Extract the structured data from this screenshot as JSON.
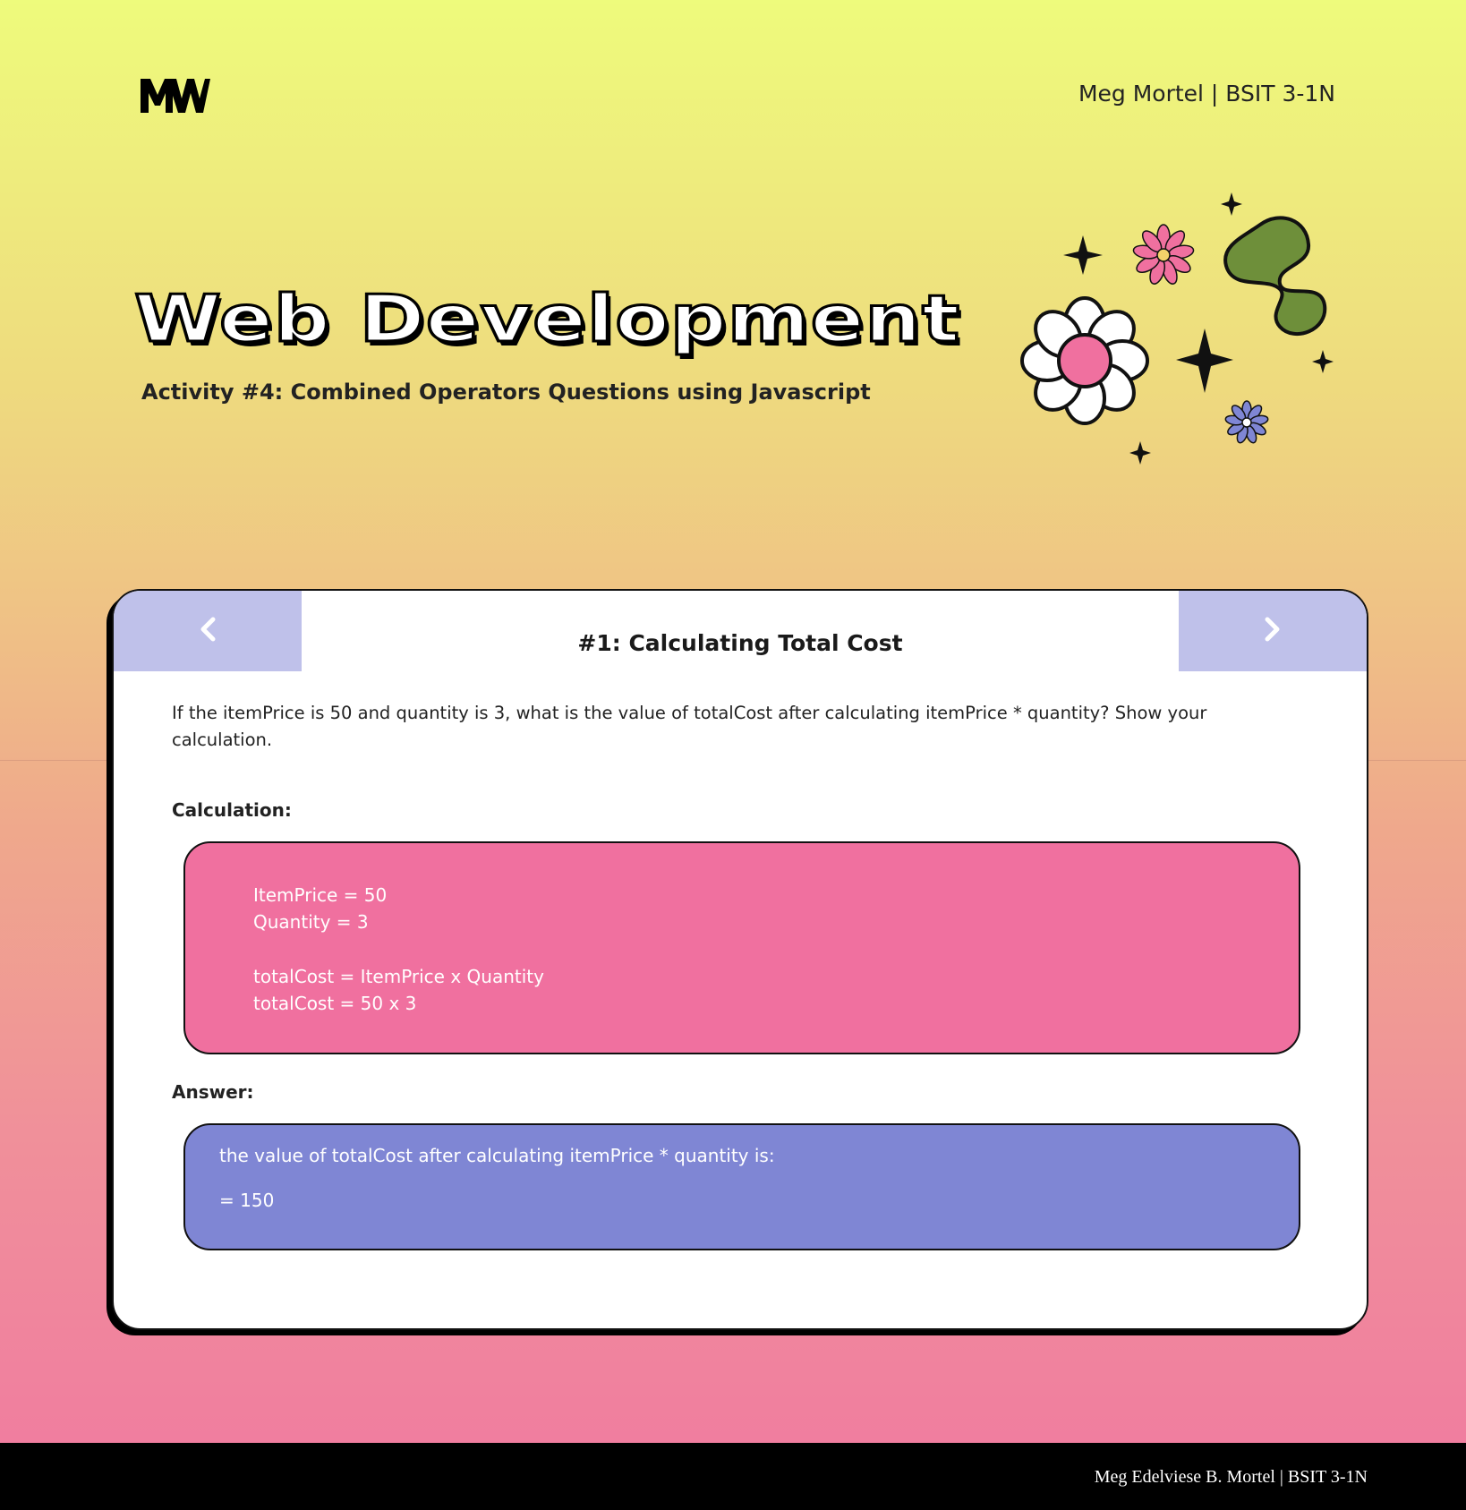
{
  "logo": {
    "text": "MW",
    "icon": "mw-logo-icon"
  },
  "header": {
    "author": "Meg Mortel | BSIT 3-1N"
  },
  "hero": {
    "title": "Web Development",
    "subtitle": "Activity #4: Combined Operators Questions using Javascript",
    "decoration": "flowers-and-sparkles-icon"
  },
  "colors": {
    "accent_pink": "#f0709f",
    "accent_purple": "#7f86d4",
    "nav_lavender": "#bfc1ea",
    "footer": "#000000"
  },
  "card": {
    "prev_icon": "chevron-left-icon",
    "next_icon": "chevron-right-icon",
    "question_title": "#1: Calculating Total Cost",
    "question_text": "If the itemPrice is 50 and quantity is 3, what is the value of totalCost after calculating itemPrice * quantity? Show your calculation.",
    "calculation_label": "Calculation:",
    "calculation_lines": [
      "ItemPrice = 50",
      "Quantity = 3",
      "totalCost = ItemPrice x Quantity",
      "totalCost = 50 x 3"
    ],
    "answer_label": "Answer:",
    "answer_lines": [
      "the value of totalCost after calculating itemPrice * quantity is:",
      "= 150"
    ]
  },
  "footer": {
    "text": "Meg Edelviese B. Mortel | BSIT 3-1N"
  }
}
